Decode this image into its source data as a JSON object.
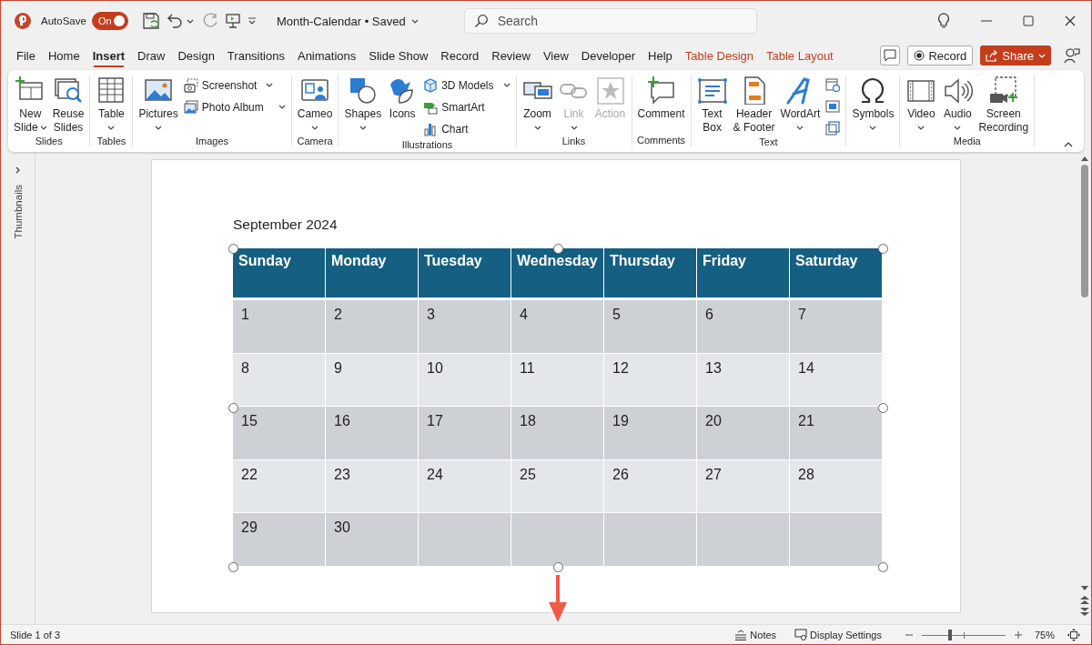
{
  "title_bar": {
    "autosave": {
      "label": "AutoSave",
      "state_text": "On",
      "on": true
    },
    "document_title": "Month-Calendar • Saved",
    "search": {
      "placeholder": "Search"
    }
  },
  "tabs": [
    {
      "label": "File",
      "selected": false,
      "kind": "normal"
    },
    {
      "label": "Home",
      "selected": false,
      "kind": "normal"
    },
    {
      "label": "Insert",
      "selected": true,
      "kind": "normal"
    },
    {
      "label": "Draw",
      "selected": false,
      "kind": "normal"
    },
    {
      "label": "Design",
      "selected": false,
      "kind": "normal"
    },
    {
      "label": "Transitions",
      "selected": false,
      "kind": "normal"
    },
    {
      "label": "Animations",
      "selected": false,
      "kind": "normal"
    },
    {
      "label": "Slide Show",
      "selected": false,
      "kind": "normal"
    },
    {
      "label": "Record",
      "selected": false,
      "kind": "normal"
    },
    {
      "label": "Review",
      "selected": false,
      "kind": "normal"
    },
    {
      "label": "View",
      "selected": false,
      "kind": "normal"
    },
    {
      "label": "Developer",
      "selected": false,
      "kind": "normal"
    },
    {
      "label": "Help",
      "selected": false,
      "kind": "normal"
    },
    {
      "label": "Table Design",
      "selected": false,
      "kind": "contextual"
    },
    {
      "label": "Table Layout",
      "selected": false,
      "kind": "contextual"
    }
  ],
  "tab_bar_actions": {
    "record": "Record",
    "share": "Share"
  },
  "ribbon": {
    "groups": [
      {
        "label": "Slides",
        "items": [
          {
            "kind": "large",
            "lines": [
              "New",
              "Slide"
            ],
            "dropdown": true,
            "disabled": false
          },
          {
            "kind": "large",
            "lines": [
              "Reuse",
              "Slides"
            ],
            "dropdown": false,
            "disabled": false
          }
        ]
      },
      {
        "label": "Tables",
        "items": [
          {
            "kind": "large",
            "lines": [
              "Table"
            ],
            "dropdown": true,
            "disabled": false
          }
        ]
      },
      {
        "label": "Images",
        "items": [
          {
            "kind": "large",
            "lines": [
              "Pictures"
            ],
            "dropdown": true,
            "disabled": false
          },
          {
            "kind": "stack",
            "items": [
              {
                "label": "Screenshot",
                "dropdown": true,
                "disabled": false
              },
              {
                "label": "Photo Album",
                "dropdown": true,
                "disabled": false
              }
            ]
          }
        ]
      },
      {
        "label": "Camera",
        "items": [
          {
            "kind": "large",
            "lines": [
              "Cameo"
            ],
            "dropdown": true,
            "disabled": false
          }
        ]
      },
      {
        "label": "Illustrations",
        "items": [
          {
            "kind": "large",
            "lines": [
              "Shapes"
            ],
            "dropdown": true,
            "disabled": false
          },
          {
            "kind": "large",
            "lines": [
              "Icons"
            ],
            "dropdown": false,
            "disabled": false
          },
          {
            "kind": "stack",
            "items": [
              {
                "label": "3D Models",
                "dropdown": true,
                "disabled": false
              },
              {
                "label": "SmartArt",
                "dropdown": false,
                "disabled": false
              },
              {
                "label": "Chart",
                "dropdown": false,
                "disabled": false
              }
            ]
          }
        ]
      },
      {
        "label": "Links",
        "items": [
          {
            "kind": "large",
            "lines": [
              "Zoom"
            ],
            "dropdown": true,
            "disabled": false
          },
          {
            "kind": "large",
            "lines": [
              "Link"
            ],
            "dropdown": true,
            "disabled": true
          },
          {
            "kind": "large",
            "lines": [
              "Action"
            ],
            "dropdown": false,
            "disabled": true
          }
        ]
      },
      {
        "label": "Comments",
        "items": [
          {
            "kind": "large",
            "lines": [
              "Comment"
            ],
            "dropdown": false,
            "disabled": false
          }
        ]
      },
      {
        "label": "Text",
        "items": [
          {
            "kind": "large",
            "lines": [
              "Text",
              "Box"
            ],
            "dropdown": false,
            "disabled": false
          },
          {
            "kind": "large",
            "lines": [
              "Header",
              "& Footer"
            ],
            "dropdown": false,
            "disabled": false
          },
          {
            "kind": "large",
            "lines": [
              "WordArt"
            ],
            "dropdown": true,
            "disabled": false
          },
          {
            "kind": "icons",
            "items": [
              {
                "disabled": false
              },
              {
                "disabled": false
              },
              {
                "disabled": false
              }
            ]
          }
        ]
      },
      {
        "items": [
          {
            "kind": "large",
            "lines": [
              "Symbols"
            ],
            "dropdown": true,
            "disabled": false
          }
        ]
      },
      {
        "label": "Media",
        "items": [
          {
            "kind": "large",
            "lines": [
              "Video"
            ],
            "dropdown": true,
            "disabled": false
          },
          {
            "kind": "large",
            "lines": [
              "Audio"
            ],
            "dropdown": true,
            "disabled": false
          },
          {
            "kind": "large",
            "lines": [
              "Screen",
              "Recording"
            ],
            "dropdown": false,
            "disabled": false
          }
        ]
      }
    ]
  },
  "thumbnails_pane": {
    "label": "Thumbnails"
  },
  "slide": {
    "title": "September 2024",
    "table": {
      "columns": [
        "Sunday",
        "Monday",
        "Tuesday",
        "Wednesday",
        "Thursday",
        "Friday",
        "Saturday"
      ],
      "rows": [
        [
          "1",
          "2",
          "3",
          "4",
          "5",
          "6",
          "7"
        ],
        [
          "8",
          "9",
          "10",
          "11",
          "12",
          "13",
          "14"
        ],
        [
          "15",
          "16",
          "17",
          "18",
          "19",
          "20",
          "21"
        ],
        [
          "22",
          "23",
          "24",
          "25",
          "26",
          "27",
          "28"
        ],
        [
          "29",
          "30"
        ]
      ]
    }
  },
  "status_bar": {
    "slide_info": "Slide 1 of 3",
    "notes": "Notes",
    "display_settings": "Display Settings",
    "zoom": {
      "level": 0.34
    },
    "zoom_percent": "75%"
  }
}
